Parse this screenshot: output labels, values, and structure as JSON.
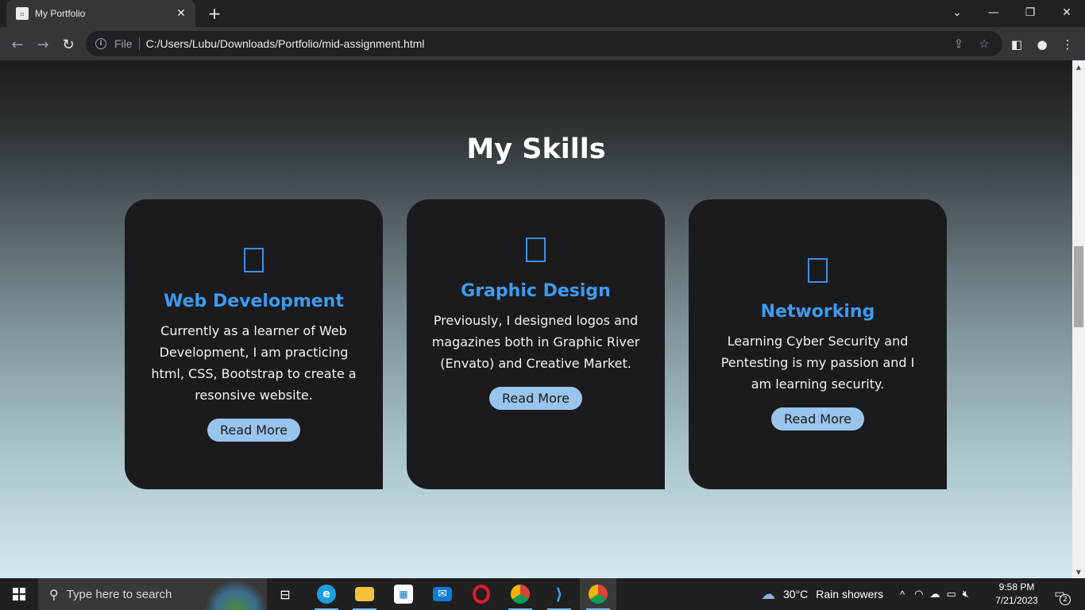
{
  "browser": {
    "tab_title": "My Portfolio",
    "tab_close": "✕",
    "new_tab": "+",
    "url_scheme": "File",
    "url": "C:/Users/Lubu/Downloads/Portfolio/mid-assignment.html"
  },
  "page": {
    "section_title": "My Skills",
    "cards": [
      {
        "icon": "missing-glyph-icon",
        "title": "Web Development",
        "text": "Currently as a learner of Web Development, I am practicing html, CSS, Bootstrap to create a resonsive website.",
        "button": "Read More"
      },
      {
        "icon": "missing-glyph-icon",
        "title": "Graphic Design",
        "text": "Previously, I designed logos and magazines both in Graphic River (Envato) and Creative Market.",
        "button": "Read More"
      },
      {
        "icon": "missing-glyph-icon",
        "title": "Networking",
        "text": "Learning Cyber Security and Pentesting is my passion and I am learning security.",
        "button": "Read More"
      }
    ],
    "title_color": "#3d9bf0",
    "button_color": "#99c4ec",
    "card_color": "#1b1b1d"
  },
  "taskbar": {
    "search_placeholder": "Type here to search",
    "weather_temp": "30°C",
    "weather_text": "Rain showers",
    "time": "9:58 PM",
    "date": "7/21/2023",
    "notification_count": "2"
  }
}
